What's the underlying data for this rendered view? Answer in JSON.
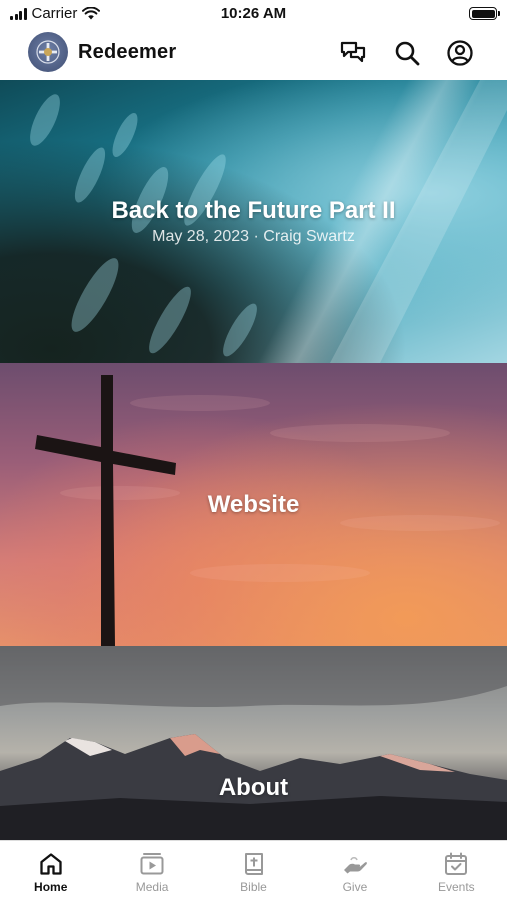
{
  "status_bar": {
    "carrier": "Carrier",
    "time": "10:26 AM"
  },
  "header": {
    "brand": "Redeemer",
    "icons": [
      "chat-icon",
      "search-icon",
      "account-icon"
    ]
  },
  "cards": [
    {
      "title": "Back to the Future Part II",
      "subtitle": "May 28, 2023 · Craig Swartz"
    },
    {
      "title": "Website"
    },
    {
      "title": "About"
    }
  ],
  "tabbar": {
    "active": "Home",
    "tabs": [
      {
        "label": "Home",
        "icon": "home-icon"
      },
      {
        "label": "Media",
        "icon": "media-icon"
      },
      {
        "label": "Bible",
        "icon": "bible-icon"
      },
      {
        "label": "Give",
        "icon": "give-icon"
      },
      {
        "label": "Events",
        "icon": "events-icon"
      }
    ]
  },
  "colors": {
    "active_tab": "#111111",
    "inactive_tab": "#999999"
  }
}
